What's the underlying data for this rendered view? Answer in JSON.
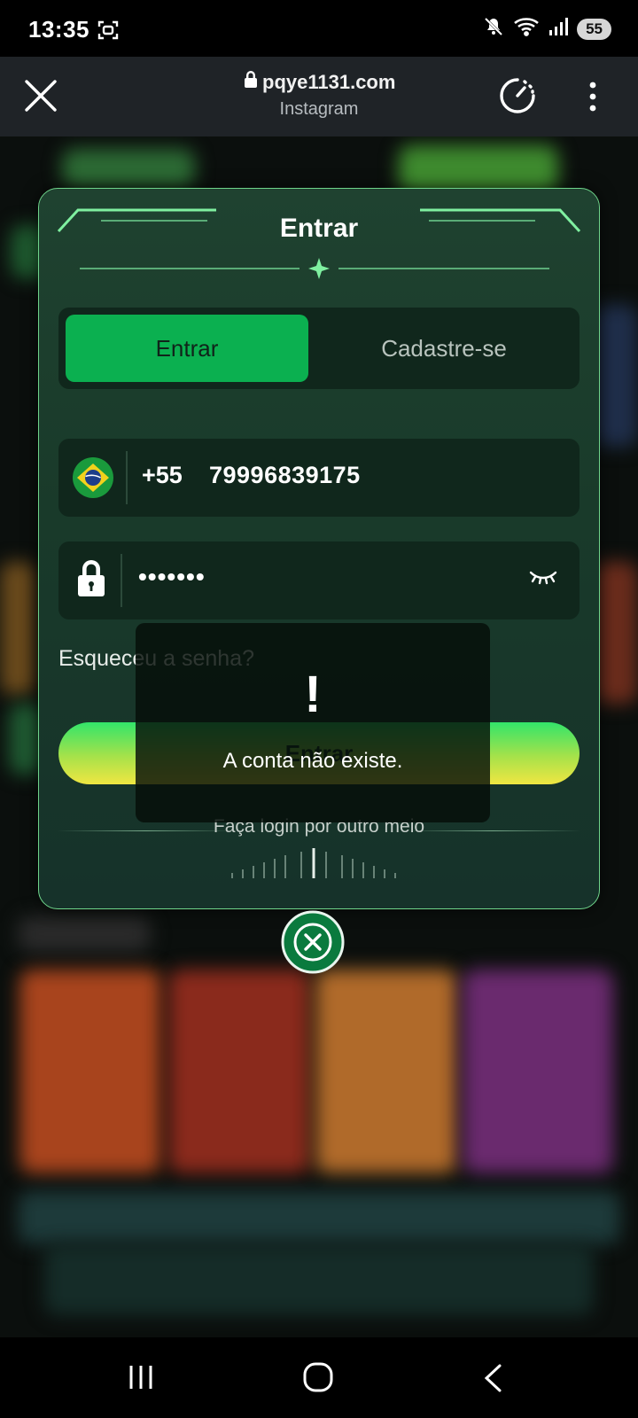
{
  "status_bar": {
    "time": "13:35",
    "battery": "55"
  },
  "browser": {
    "url": "pqye1131.com",
    "source": "Instagram"
  },
  "login": {
    "title": "Entrar",
    "tabs": [
      {
        "label": "Entrar",
        "active": true
      },
      {
        "label": "Cadastre-se",
        "active": false
      }
    ],
    "phone": {
      "country_code": "+55",
      "number": "79996839175",
      "flag": "brazil-flag-icon"
    },
    "password": {
      "masked_value": "•••••••"
    },
    "forgot_label": "Esqueceu a senha?",
    "submit_label": "Entrar",
    "other_login_label": "Faça login por outro meio"
  },
  "toast": {
    "icon": "!",
    "message": "A conta não existe."
  },
  "colors": {
    "accent_green": "#0bb050",
    "modal_border": "#6fd58b",
    "button_gradient_top": "#33e46a",
    "button_gradient_bottom": "#f0e642"
  }
}
